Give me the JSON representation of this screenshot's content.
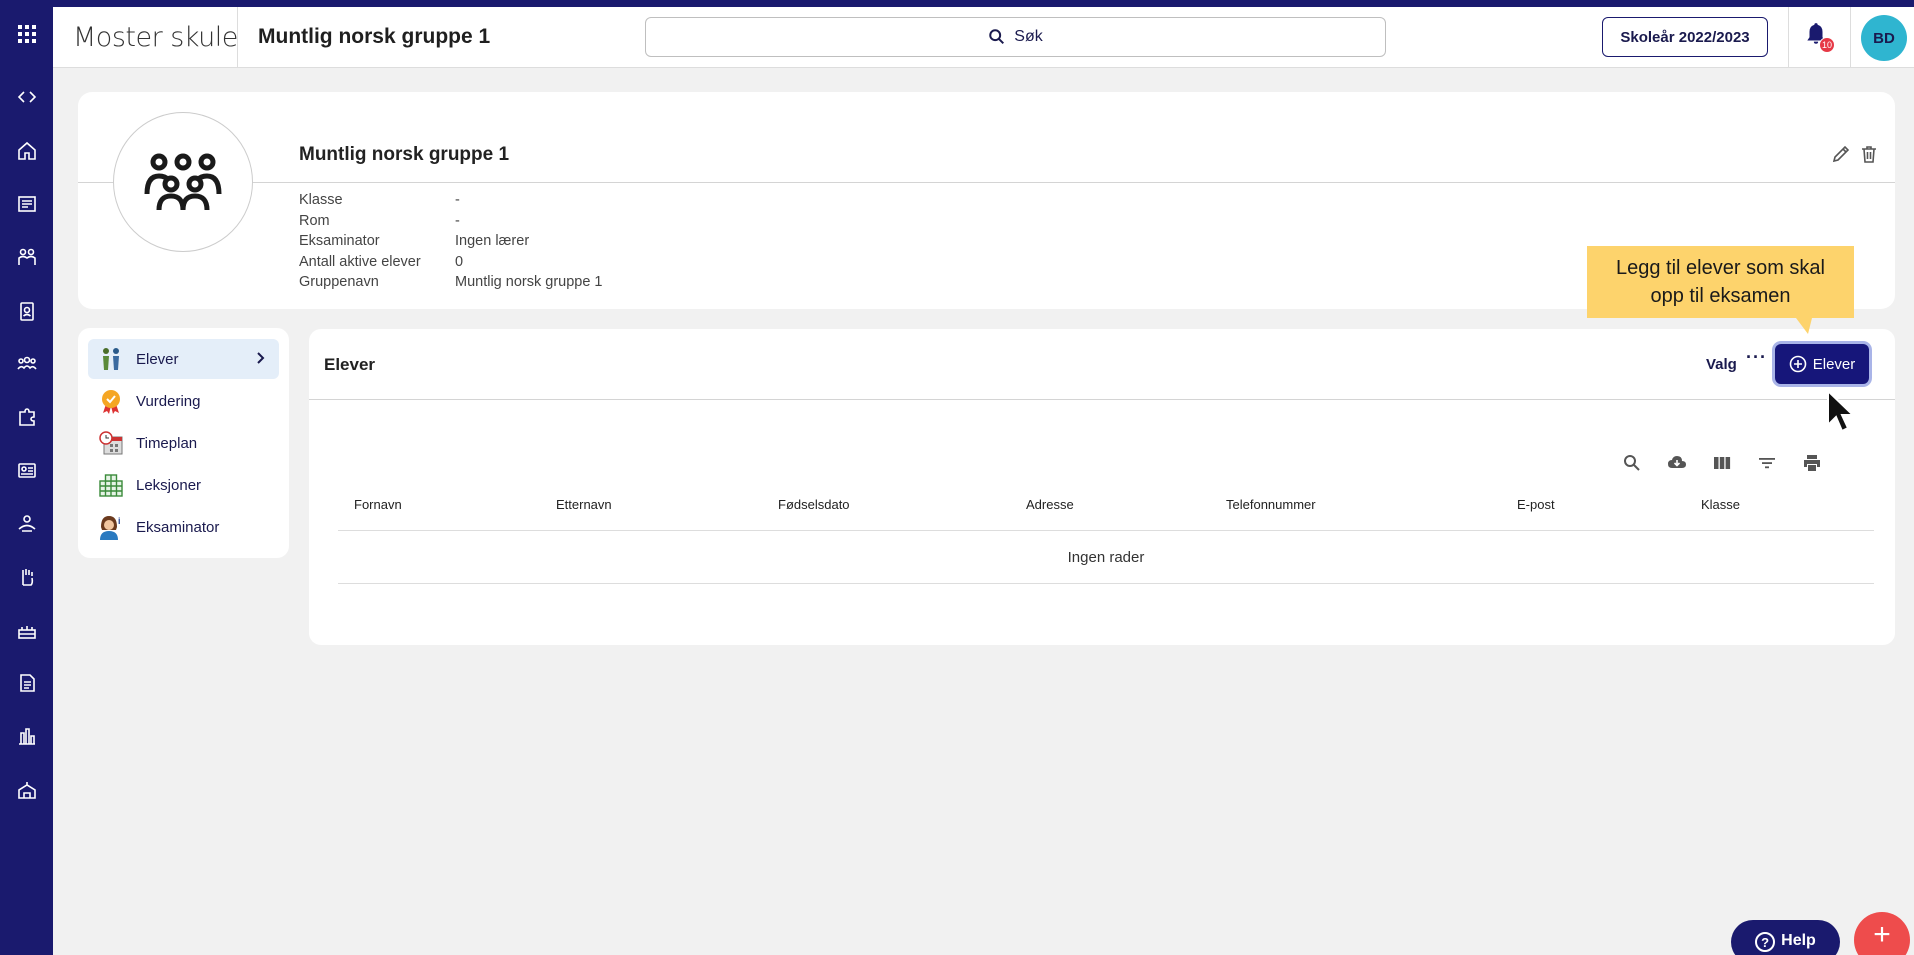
{
  "header": {
    "org_name": "Moster skule",
    "group_title": "Muntlig norsk gruppe 1",
    "search_label": "Søk",
    "school_year": "Skoleår 2022/2023",
    "notification_count": "10",
    "user_initials": "BD"
  },
  "profile": {
    "name": "Muntlig norsk gruppe 1",
    "rows": [
      {
        "label": "Klasse",
        "value": "-"
      },
      {
        "label": "Rom",
        "value": "-"
      },
      {
        "label": "Eksaminator",
        "value": "Ingen lærer"
      },
      {
        "label": "Antall aktive elever",
        "value": "0"
      },
      {
        "label": "Gruppenavn",
        "value": "Muntlig norsk gruppe 1"
      }
    ]
  },
  "sidemenu": {
    "items": [
      {
        "label": "Elever",
        "icon": "students-icon"
      },
      {
        "label": "Vurdering",
        "icon": "award-icon"
      },
      {
        "label": "Timeplan",
        "icon": "calendar-clock-icon"
      },
      {
        "label": "Leksjoner",
        "icon": "grid-icon"
      },
      {
        "label": "Eksaminator",
        "icon": "examiner-icon"
      }
    ]
  },
  "main": {
    "title": "Elever",
    "valg_label": "Valg",
    "more_label": "···",
    "add_label": "Elever",
    "columns": [
      "Fornavn",
      "Etternavn",
      "Fødselsdato",
      "Adresse",
      "Telefonnummer",
      "E-post",
      "Klasse"
    ],
    "empty_text": "Ingen rader"
  },
  "tooltip": {
    "line1": "Legg til elever som skal",
    "line2": "opp til eksamen"
  },
  "floating": {
    "help_label": "Help",
    "help_q": "?",
    "fab_label": "+"
  },
  "colors": {
    "rail": "#1a1a6e",
    "accent": "#16167a",
    "tooltip": "#fdd36c",
    "fab": "#ee4c4c",
    "avatar": "#2fb5d0"
  }
}
